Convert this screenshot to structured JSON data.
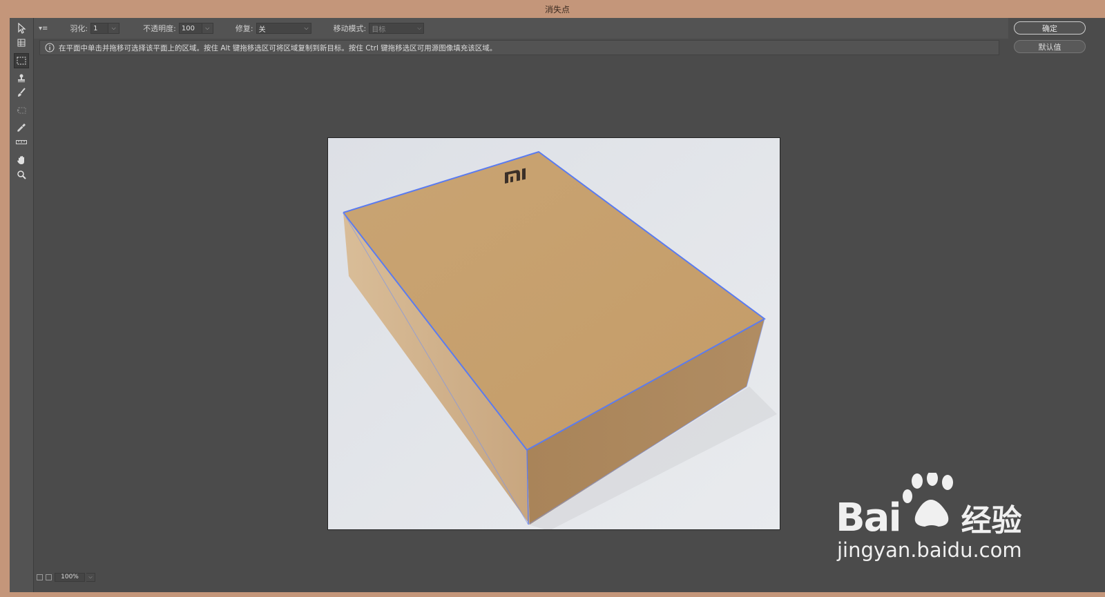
{
  "window": {
    "title": "消失点"
  },
  "options": {
    "feather_label": "羽化:",
    "feather_value": "1",
    "opacity_label": "不透明度:",
    "opacity_value": "100",
    "heal_label": "修复:",
    "heal_value": "关",
    "move_mode_label": "移动模式:",
    "move_mode_value": "目标"
  },
  "info": {
    "message": "在平面中单击并拖移可选择该平面上的区域。按住 Alt 键拖移选区可将区域复制到新目标。按住 Ctrl 键拖移选区可用源图像填充该区域。"
  },
  "buttons": {
    "ok": "确定",
    "default": "默认值"
  },
  "status": {
    "zoom": "100%"
  },
  "watermark": {
    "brand": "Bai",
    "brand_cn": "经验",
    "url": "jingyan.baidu.com"
  },
  "image": {
    "logo_text": "mi"
  },
  "colors": {
    "accent_plane": "#5a7bf0",
    "toolbox_bg": "#535353",
    "canvas_bg": "#4b4b4b"
  }
}
